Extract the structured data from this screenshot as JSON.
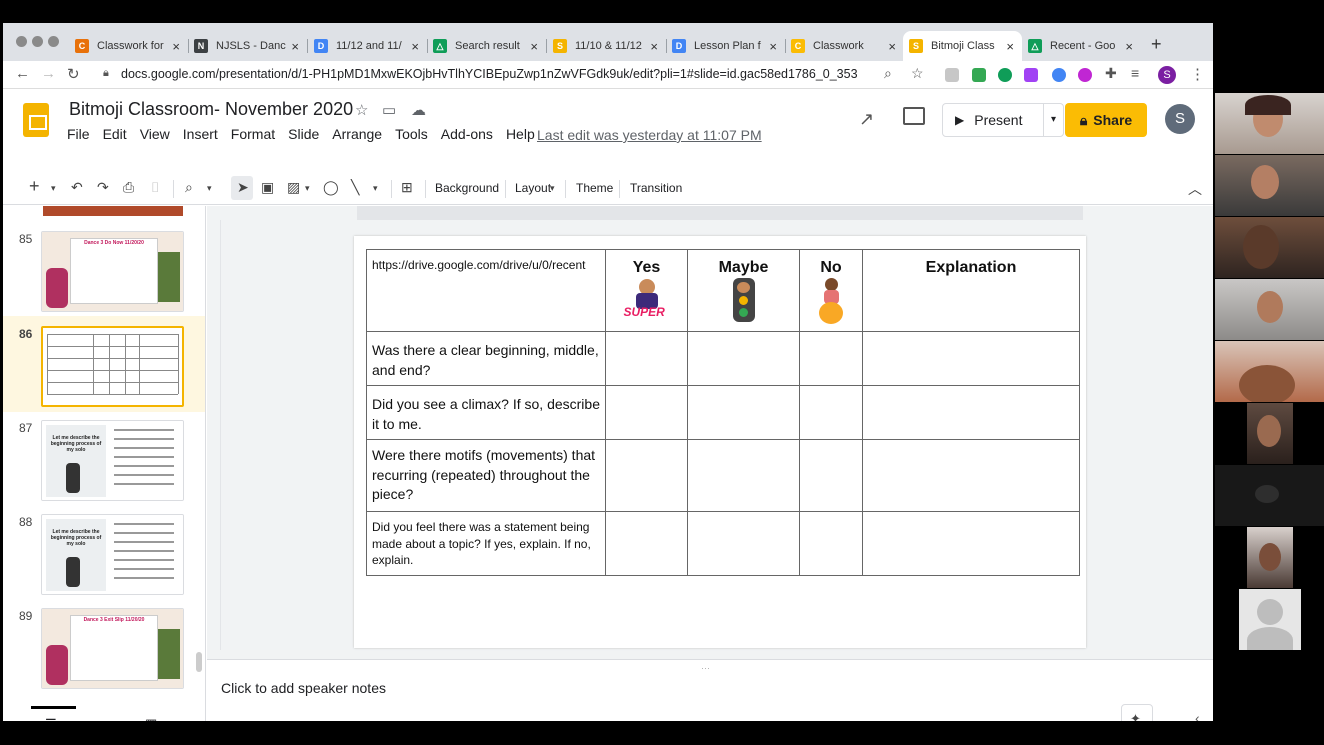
{
  "browser": {
    "tabs": [
      {
        "label": "Classwork for",
        "color": "#e8710a",
        "glyph": "C"
      },
      {
        "label": "NJSLS - Danc",
        "color": "#3c4043",
        "glyph": "N"
      },
      {
        "label": "11/12 and 11/",
        "color": "#4285f4",
        "glyph": "D"
      },
      {
        "label": "Search result",
        "color": "#0f9d58",
        "glyph": "△"
      },
      {
        "label": "11/10 & 11/12",
        "color": "#f4b400",
        "glyph": "S"
      },
      {
        "label": "Lesson Plan f",
        "color": "#4285f4",
        "glyph": "D"
      },
      {
        "label": "Classwork",
        "color": "#fbbc04",
        "glyph": "C"
      },
      {
        "label": "Bitmoji Class",
        "color": "#f4b400",
        "glyph": "S"
      },
      {
        "label": "Recent - Goo",
        "color": "#0f9d58",
        "glyph": "△"
      }
    ],
    "active_tab": 7,
    "url": "docs.google.com/presentation/d/1-PH1pMD1MxwEKOjbHvTlhYCIBEpuZwp1nZwVFGdk9uk/edit?pli=1#slide=id.gac58ed1786_0_353",
    "profile_initial": "S"
  },
  "doc": {
    "title": "Bitmoji Classroom- November 2020",
    "menu": [
      "File",
      "Edit",
      "View",
      "Insert",
      "Format",
      "Slide",
      "Arrange",
      "Tools",
      "Add-ons",
      "Help"
    ],
    "last_edit": "Last edit was yesterday at 11:07 PM",
    "present_label": "Present",
    "share_label": "Share",
    "avatar_initial": "S"
  },
  "toolbar": {
    "background_label": "Background",
    "layout_label": "Layout",
    "theme_label": "Theme",
    "transition_label": "Transition"
  },
  "filmstrip": {
    "slides": [
      {
        "num": "85",
        "title": "Dance 3 Do Now 11/20/20"
      },
      {
        "num": "86",
        "title": ""
      },
      {
        "num": "87",
        "title": "Let me describe the beginning process of my solo"
      },
      {
        "num": "88",
        "title": "Let me describe the beginning process of my solo"
      },
      {
        "num": "89",
        "title": "Dance 3 Exit Slip 11/20/20"
      }
    ],
    "selected": "86"
  },
  "slide": {
    "header_cell": "https://drive.google.com/drive/u/0/recent",
    "columns": [
      "Yes",
      "Maybe",
      "No",
      "Explanation"
    ],
    "yes_sticker_text": "SUPER",
    "questions": [
      "Was there a clear beginning, middle, and end?",
      "Did you see a climax? If so, describe it to me.",
      "Were there motifs (movements) that recurring (repeated) throughout the piece?",
      "Did you feel there was a statement being made about a topic? If yes, explain. If no, explain."
    ]
  },
  "notes": {
    "placeholder": "Click to add speaker notes"
  },
  "colors": {
    "accent_yellow": "#fbbc04",
    "slides_yellow": "#f4b400",
    "selection_bg": "#fef7e0"
  }
}
